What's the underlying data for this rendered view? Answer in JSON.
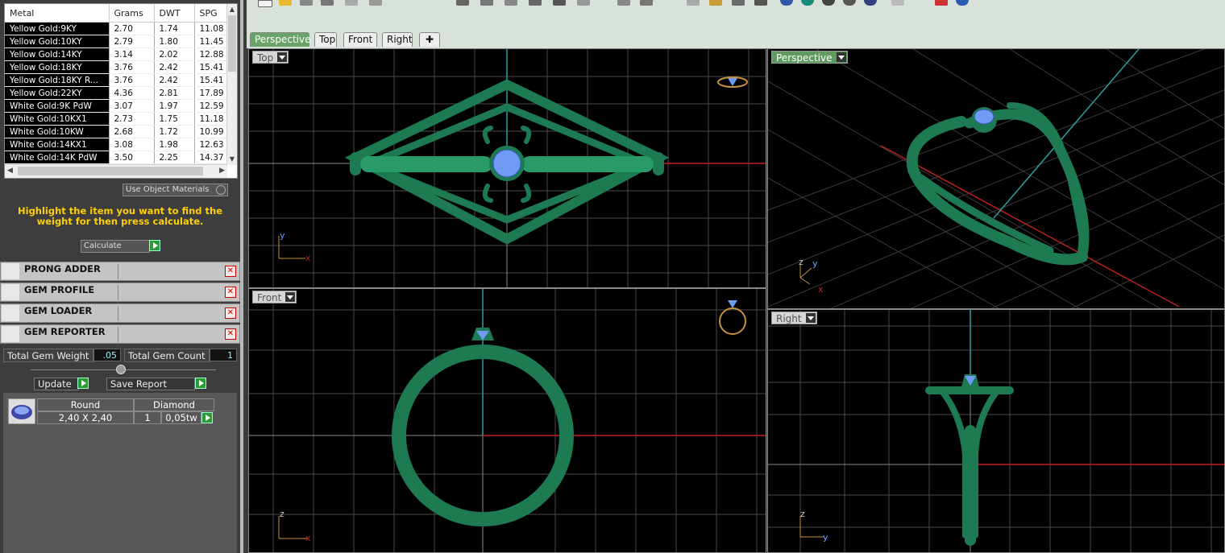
{
  "metals": {
    "headers": [
      "Metal",
      "Grams",
      "DWT",
      "SPG"
    ],
    "rows": [
      {
        "name": "Yellow Gold:9KY",
        "grams": "2.70",
        "dwt": "1.74",
        "spg": "11.08"
      },
      {
        "name": "Yellow Gold:10KY",
        "grams": "2.79",
        "dwt": "1.80",
        "spg": "11.45"
      },
      {
        "name": "Yellow Gold:14KY",
        "grams": "3.14",
        "dwt": "2.02",
        "spg": "12.88"
      },
      {
        "name": "Yellow Gold:18KY",
        "grams": "3.76",
        "dwt": "2.42",
        "spg": "15.41"
      },
      {
        "name": "Yellow Gold:18KY R...",
        "grams": "3.76",
        "dwt": "2.42",
        "spg": "15.41"
      },
      {
        "name": "Yellow Gold:22KY",
        "grams": "4.36",
        "dwt": "2.81",
        "spg": "17.89"
      },
      {
        "name": "White Gold:9K PdW",
        "grams": "3.07",
        "dwt": "1.97",
        "spg": "12.59"
      },
      {
        "name": "White Gold:10KX1",
        "grams": "2.73",
        "dwt": "1.75",
        "spg": "11.18"
      },
      {
        "name": "White Gold:10KW",
        "grams": "2.68",
        "dwt": "1.72",
        "spg": "10.99"
      },
      {
        "name": "White Gold:14KX1",
        "grams": "3.08",
        "dwt": "1.98",
        "spg": "12.63"
      },
      {
        "name": "White Gold:14K PdW",
        "grams": "3.50",
        "dwt": "2.25",
        "spg": "14.37"
      }
    ]
  },
  "use_object_materials": "Use Object Materials",
  "hint": "Highlight the item you want to find the weight for then press calculate.",
  "calculate_label": "Calculate",
  "plugins": [
    "PRONG ADDER",
    "GEM PROFILE",
    "GEM LOADER",
    "GEM REPORTER"
  ],
  "gem_report": {
    "total_weight_label": "Total Gem Weight",
    "total_weight": ".05",
    "total_count_label": "Total Gem Count",
    "total_count": "1",
    "update_label": "Update",
    "save_label": "Save Report",
    "gems": [
      {
        "shape": "Round",
        "material": "Diamond",
        "size": "2,40 X 2,40",
        "count": "1",
        "weight": "0,05tw"
      }
    ]
  },
  "tabs": [
    "Perspective",
    "Top",
    "Front",
    "Right"
  ],
  "viewports": {
    "top": "Top",
    "perspective": "Perspective",
    "front": "Front",
    "right": "Right"
  },
  "axes": {
    "x": "x",
    "y": "y",
    "z": "z"
  },
  "colors": {
    "ring": "#1f7a55",
    "gem": "#6f9bf5",
    "accent": "#6aa36a",
    "hint": "#ffd000"
  }
}
